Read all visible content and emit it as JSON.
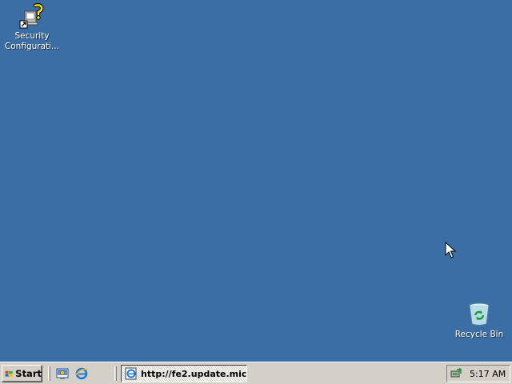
{
  "desktop": {
    "background": "#3a6ea5",
    "icons": [
      {
        "label_line1": "Security",
        "label_line2": "Configurati...",
        "icon": "security-config-shortcut-icon"
      },
      {
        "label": "Recycle Bin",
        "icon": "recycle-bin-icon"
      }
    ]
  },
  "taskbar": {
    "start_label": "Start",
    "quick_launch": [
      {
        "icon": "show-desktop-icon"
      },
      {
        "icon": "internet-explorer-icon"
      }
    ],
    "tasks": [
      {
        "label": "http://fe2.update.mic...",
        "icon": "internet-explorer-page-icon",
        "active": true
      }
    ],
    "tray": {
      "icons": [
        "safely-remove-hardware-icon"
      ],
      "clock": "5:17 AM"
    }
  }
}
